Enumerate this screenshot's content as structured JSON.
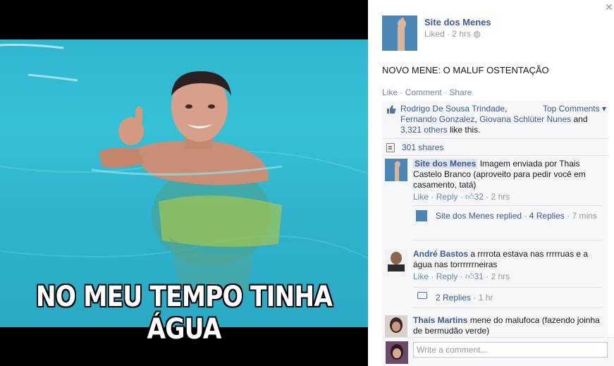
{
  "viewer": {
    "meme_caption": "NO MEU TEMPO TINHA ÁGUA"
  },
  "post": {
    "page_name": "Site dos Menes",
    "liked": "Liked",
    "time": "2 hrs",
    "text": "NOVO MENE: O MALUF OSTENTAÇÃO"
  },
  "actions": {
    "like": "Like",
    "comment": "Comment",
    "share": "Share"
  },
  "likes": {
    "name1": "Rodrigo De Sousa Trindade",
    "name2": "Fernando Gonzalez",
    "name3": "Giovana Schlüter Nunes",
    "and": "and",
    "others": "3,321 others",
    "suffix": "like this.",
    "top_comments": "Top Comments"
  },
  "shares": "301 shares",
  "comments": [
    {
      "author": "Site dos Menes",
      "text": "Imagem enviada por Thais Castelo Branco (aproveito para pedir você em casamento, tatá)",
      "like": "Like",
      "reply": "Reply",
      "likes": "32",
      "time": "2 hrs",
      "replies_summary": "Site dos Menes replied",
      "replies_count": "4 Replies",
      "replies_time": "7 mins"
    },
    {
      "author": "André Bastos",
      "text": "a rrrrota estava nas rrrrruas e a água nas torrrrrrneiras",
      "like": "Like",
      "reply": "Reply",
      "likes": "31",
      "time": "2 hrs",
      "replies_count": "2 Replies",
      "replies_time": "1 hr"
    },
    {
      "author": "Thaís Martins",
      "text": "mene do malufoca (fazendo joinha de bermudão verde)"
    }
  ],
  "composer": {
    "placeholder": "Write a comment..."
  },
  "colors": {
    "link": "#3b5998",
    "pool": "#2fb6cf",
    "panel_bg": "#f6f7f8"
  }
}
